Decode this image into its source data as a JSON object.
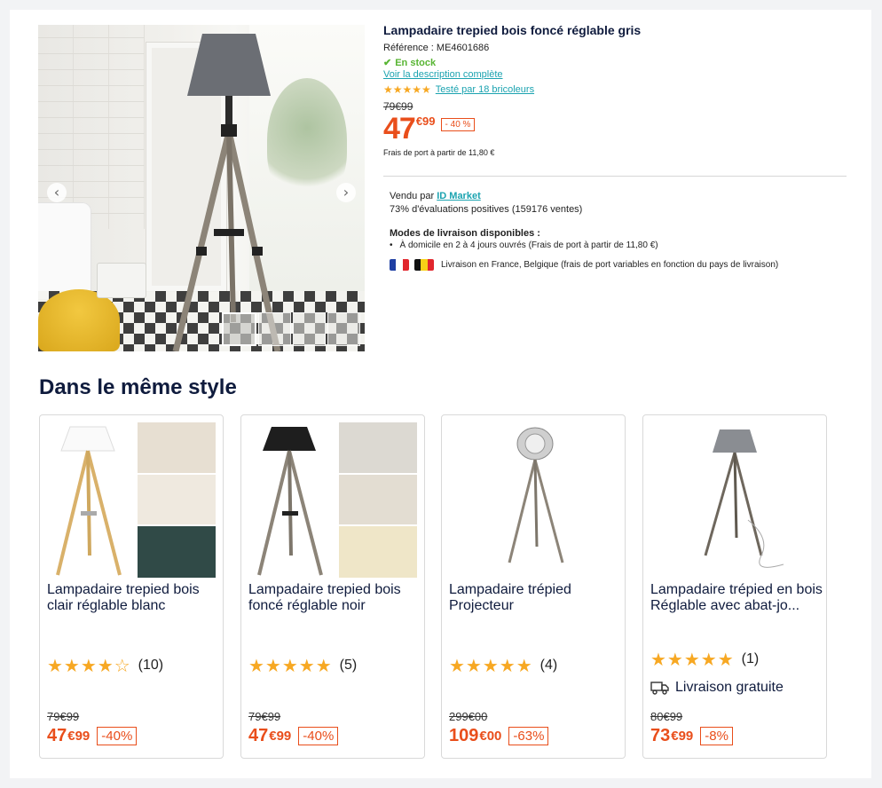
{
  "product": {
    "title": "Lampadaire trepied bois foncé réglable gris",
    "reference": "Référence : ME4601686",
    "stock": "En stock",
    "description_link": "Voir la description complète",
    "tested_link": "Testé par 18 bricoleurs",
    "rating_stars": 5,
    "old_price": "79€99",
    "price_main": "47",
    "price_cents": "€99",
    "discount": "- 40 %",
    "shipping": "Frais de port à partir de 11,80 €"
  },
  "gallery": {
    "prev_icon": "chevron-left-icon",
    "next_icon": "chevron-right-icon",
    "thumbnail_count": 4
  },
  "seller": {
    "sold_by_prefix": "Vendu par",
    "sold_by_link": "ID Market",
    "evaluations": "73% d'évaluations positives (159176 ventes)",
    "delivery_title": "Modes de livraison disponibles :",
    "delivery_mode": "À domicile en 2 à 4 jours ouvrés (Frais de port à partir de 11,80 €)",
    "delivery_countries": "Livraison en France, Belgique (frais de port variables en fonction du pays de livraison)"
  },
  "same_style": {
    "title": "Dans le même style",
    "cards": [
      {
        "name": "Lampadaire trepied bois clair réglable blanc",
        "stars": "★★★★☆",
        "count": "(10)",
        "old_price": "79€99",
        "price_main": "47",
        "price_cents": "€99",
        "discount": "-40%"
      },
      {
        "name": "Lampadaire trepied bois foncé réglable noir",
        "stars": "★★★★★",
        "count": "(5)",
        "old_price": "79€99",
        "price_main": "47",
        "price_cents": "€99",
        "discount": "-40%"
      },
      {
        "name": "Lampadaire trépied Projecteur",
        "stars": "★★★★★",
        "count": "(4)",
        "old_price": "299€00",
        "price_main": "109",
        "price_cents": "€00",
        "discount": "-63%"
      },
      {
        "name": "Lampadaire trépied en bois Réglable avec abat-jo...",
        "stars": "★★★★★",
        "count": "(1)",
        "free_delivery": "Livraison gratuite",
        "old_price": "80€99",
        "price_main": "73",
        "price_cents": "€99",
        "discount": "-8%"
      }
    ]
  },
  "colors": {
    "price": "#e94e1b",
    "link": "#1ba3b0",
    "stock": "#58b533",
    "star": "#f7a823",
    "title": "#0f1b3d"
  }
}
